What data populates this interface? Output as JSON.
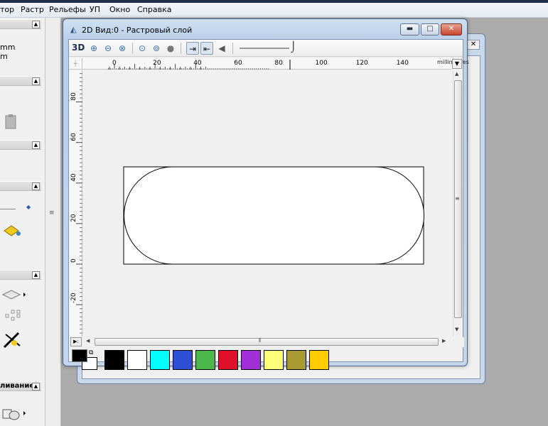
{
  "menubar": {
    "items": [
      "тор",
      "Растр",
      "Рельефы",
      "УП",
      "Окно",
      "Справка"
    ]
  },
  "leftpanel": {
    "text_lines": [
      "mm",
      "m"
    ],
    "section_bottom_label": "ливание"
  },
  "window": {
    "title": "2D Вид:0 - Растровый слой",
    "toolbar": {
      "label_3d": "3D"
    },
    "units_label": "millimetres",
    "ruler_h_labels": [
      "0",
      "20",
      "40",
      "60",
      "80",
      "100",
      "120",
      "140"
    ],
    "ruler_v_labels": [
      "80",
      "60",
      "40",
      "20",
      "0",
      "-20"
    ]
  },
  "palette": {
    "primary_color": "#000000",
    "secondary_color": "#ffffff",
    "colors": [
      "#000000",
      "#ffffff",
      "#00ffff",
      "#2e4fd6",
      "#4cb84c",
      "#e0102a",
      "#a22ed8",
      "#ffff7a",
      "#a99a32",
      "#ffcc00"
    ]
  }
}
